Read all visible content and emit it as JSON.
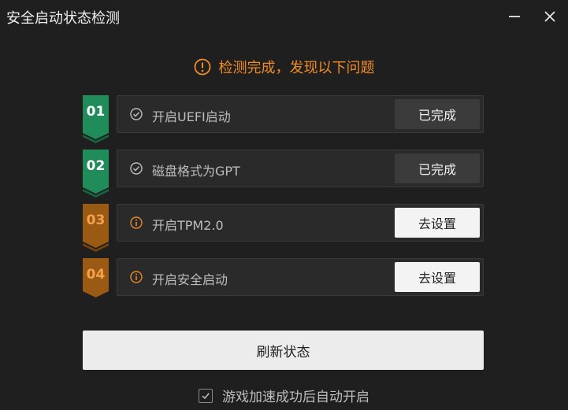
{
  "window": {
    "title": "安全启动状态检测"
  },
  "status": {
    "message": "检测完成，发现以下问题",
    "color": "#f08b26"
  },
  "steps": [
    {
      "num": "01",
      "label": "开启UEFI启动",
      "state": "done",
      "action": "已完成",
      "badge_color": "#1f8c5a",
      "badge_dark": "#146543"
    },
    {
      "num": "02",
      "label": "磁盘格式为GPT",
      "state": "done",
      "action": "已完成",
      "badge_color": "#1f8c5a",
      "badge_dark": "#146543"
    },
    {
      "num": "03",
      "label": "开启TPM2.0",
      "state": "warning",
      "action": "去设置",
      "badge_color": "#9b5a13",
      "badge_dark": "#76420d"
    },
    {
      "num": "04",
      "label": "开启安全启动",
      "state": "warning",
      "action": "去设置",
      "badge_color": "#9b5a13",
      "badge_dark": "#76420d"
    }
  ],
  "refresh_button": {
    "label": "刷新状态"
  },
  "auto_start": {
    "label": "游戏加速成功后自动开启",
    "checked": true
  },
  "icons": {
    "minimize": "minimize-icon",
    "close": "close-icon",
    "status": "warning-circle-icon",
    "done": "check-circle-icon",
    "warning": "info-circle-icon",
    "checkbox": "checkmark-icon"
  }
}
